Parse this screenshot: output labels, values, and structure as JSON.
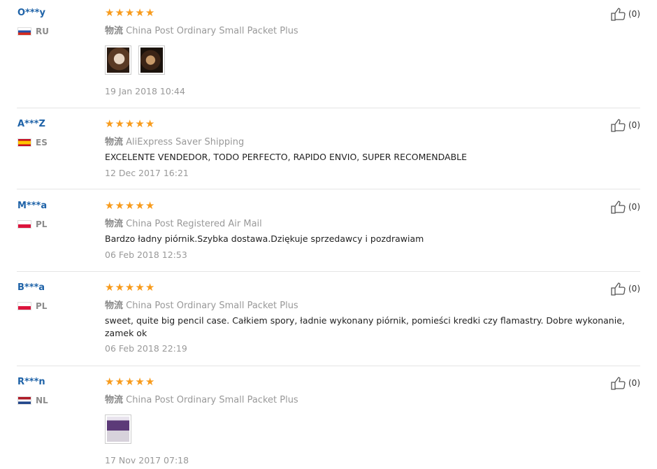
{
  "reviews": [
    {
      "user": "O***y",
      "country": "RU",
      "shipping_label": "物流",
      "shipping": "China Post Ordinary Small Packet Plus",
      "text": "",
      "date": "19 Jan 2018 10:44",
      "likes": "(0)",
      "images": [
        "photo-pencil-case-1",
        "photo-pencil-case-2"
      ],
      "rating": 5
    },
    {
      "user": "A***Z",
      "country": "ES",
      "shipping_label": "物流",
      "shipping": "AliExpress Saver Shipping",
      "text": "EXCELENTE VENDEDOR, TODO PERFECTO, RAPIDO ENVIO, SUPER RECOMENDABLE",
      "date": "12 Dec 2017 16:21",
      "likes": "(0)",
      "rating": 5
    },
    {
      "user": "M***a",
      "country": "PL",
      "shipping_label": "物流",
      "shipping": "China Post Registered Air Mail",
      "text": "Bardzo ładny piórnik.Szybka dostawa.Dziękuje sprzedawcy i pozdrawiam",
      "date": "06 Feb 2018 12:53",
      "likes": "(0)",
      "rating": 5
    },
    {
      "user": "B***a",
      "country": "PL",
      "shipping_label": "物流",
      "shipping": "China Post Ordinary Small Packet Plus",
      "text": "sweet, quite big pencil case. Całkiem spory, ładnie wykonany piórnik, pomieści kredki czy flamastry. Dobre wykonanie, zamek ok",
      "date": "06 Feb 2018 22:19",
      "likes": "(0)",
      "rating": 5
    },
    {
      "user": "R***n",
      "country": "NL",
      "shipping_label": "物流",
      "shipping": "China Post Ordinary Small Packet Plus",
      "text": "",
      "date": "17 Nov 2017 07:18",
      "likes": "(0)",
      "images": [
        "photo-pencil-case-3"
      ],
      "rating": 5
    }
  ],
  "colors": {
    "username": "#1f63a8",
    "star": "#f89b1c",
    "muted": "#999999"
  }
}
